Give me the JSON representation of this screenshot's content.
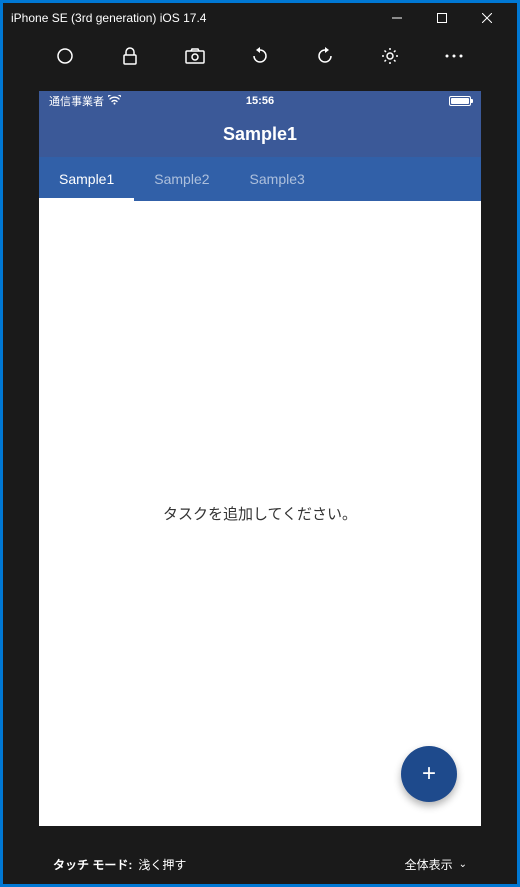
{
  "window": {
    "title": "iPhone SE (3rd generation) iOS 17.4"
  },
  "statusBar": {
    "carrier": "通信事業者",
    "time": "15:56"
  },
  "navBar": {
    "title": "Sample1"
  },
  "tabs": [
    {
      "label": "Sample1",
      "active": true
    },
    {
      "label": "Sample2",
      "active": false
    },
    {
      "label": "Sample3",
      "active": false
    }
  ],
  "content": {
    "emptyMessage": "タスクを追加してください。"
  },
  "fab": {
    "label": "+"
  },
  "bottomBar": {
    "touchModeLabel": "タッチ モード:",
    "touchModeValue": "浅く押す",
    "displayMode": "全体表示"
  }
}
